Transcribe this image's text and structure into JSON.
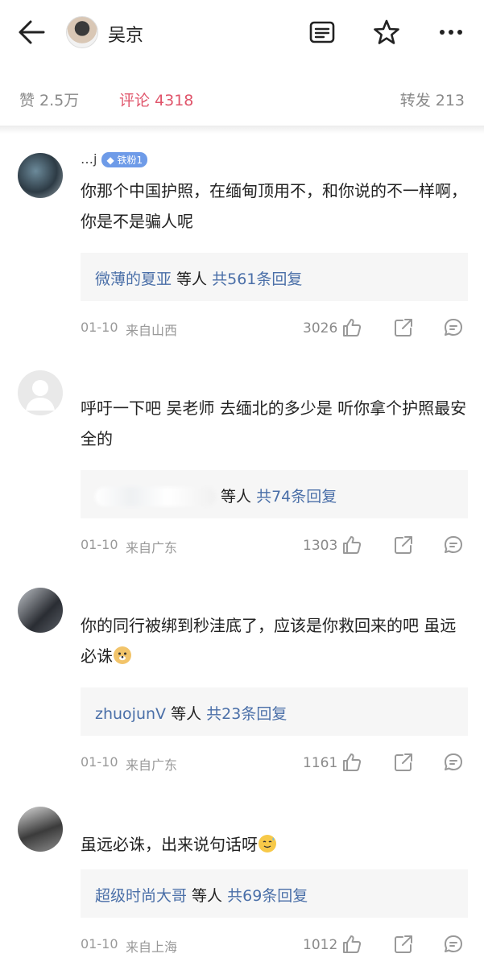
{
  "header": {
    "title": "吴京",
    "icons": [
      "back-arrow-icon",
      "reader-icon",
      "star-icon",
      "more-icon"
    ]
  },
  "stats": {
    "likes": "赞 2.5万",
    "comments": "评论 4318",
    "reposts": "转发 213"
  },
  "colors": {
    "accent": "#e0556b",
    "link": "#4a6fa8",
    "muted": "#999999",
    "badge": "#6e9be8"
  },
  "comments": [
    {
      "username": "…j",
      "badge": "铁粉1",
      "text": "你那个中国护照，在缅甸顶用不，和你说的不一样啊，你是不是骗人呢",
      "reply_users": "微薄的夏亚",
      "reply_mid": " 等人 ",
      "reply_count": "共561条回复",
      "date": "01-10",
      "location": "来自山西",
      "likes": "3026"
    },
    {
      "text": "呼吁一下吧 吴老师 去缅北的多少是 听你拿个护照最安全的",
      "reply_users": "",
      "reply_mid": " 等人 ",
      "reply_count": "共74条回复",
      "date": "01-10",
      "location": "来自广东",
      "likes": "1303"
    },
    {
      "text": "你的同行被绑到秒洼底了，应该是你救回来的吧 虽远必诛",
      "reply_users": "zhuojunV",
      "reply_mid": " 等人 ",
      "reply_count": "共23条回复",
      "date": "01-10",
      "location": "来自广东",
      "likes": "1161"
    },
    {
      "text": "虽远必诛，出来说句话呀",
      "reply_users": "超级时尚大哥",
      "reply_mid": " 等人 ",
      "reply_count": "共69条回复",
      "date": "01-10",
      "location": "来自上海",
      "likes": "1012"
    }
  ]
}
